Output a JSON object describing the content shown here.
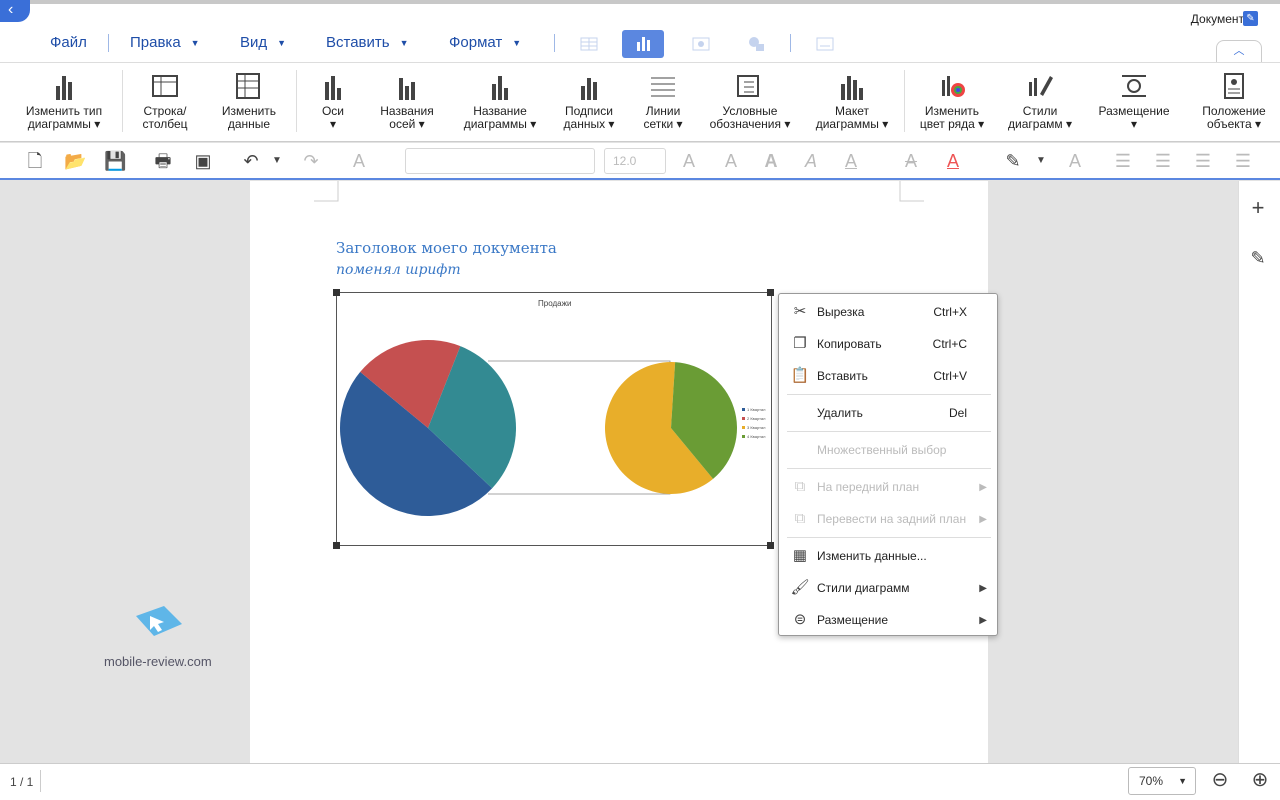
{
  "window": {
    "doc_label": "Документ"
  },
  "menu": [
    {
      "label": "Файл"
    },
    {
      "label": "Правка"
    },
    {
      "label": "Вид"
    },
    {
      "label": "Вставить"
    },
    {
      "label": "Формат"
    }
  ],
  "ribbon": [
    {
      "label": "Изменить тип\nдиаграммы ▾"
    },
    {
      "label": "Строка/\nстолбец"
    },
    {
      "label": "Изменить\nданные"
    },
    {
      "label": "Оси\n▾"
    },
    {
      "label": "Названия\nосей ▾"
    },
    {
      "label": "Название\nдиаграммы ▾"
    },
    {
      "label": "Подписи\nданных ▾"
    },
    {
      "label": "Линии\nсетки ▾"
    },
    {
      "label": "Условные\nобозначения ▾"
    },
    {
      "label": "Макет\nдиаграммы ▾"
    },
    {
      "label": "Изменить\nцвет ряда ▾"
    },
    {
      "label": "Стили\nдиаграмм ▾"
    },
    {
      "label": "Размещение\n▾"
    },
    {
      "label": "Положение\nобъекта ▾"
    }
  ],
  "format_bar": {
    "font_size": "12.0"
  },
  "document": {
    "title": "Заголовок моего документа",
    "subtitle": "поменял шрифт"
  },
  "chart_data": {
    "type": "pie",
    "title": "Продажи",
    "legend": [
      "1 Квартал",
      "2 Квартал",
      "3 Квартал",
      "4 Квартал"
    ],
    "legend_position": "right",
    "slices": [
      {
        "color": "#2e5c98",
        "share": 0.5
      },
      {
        "color": "#c55050",
        "share": 0.2
      },
      {
        "color": "#338a92",
        "share": 0.3
      }
    ],
    "secondary_slices": [
      {
        "color": "#e8ae2a",
        "share": 0.61
      },
      {
        "color": "#6a9c35",
        "share": 0.39
      }
    ],
    "colors": [
      "#2e5c98",
      "#c55050",
      "#e8ae2a",
      "#6a9c35"
    ]
  },
  "context_menu": {
    "cut": {
      "label": "Вырезка",
      "shortcut": "Ctrl+X"
    },
    "copy": {
      "label": "Копировать",
      "shortcut": "Ctrl+C"
    },
    "paste": {
      "label": "Вставить",
      "shortcut": "Ctrl+V"
    },
    "delete": {
      "label": "Удалить",
      "shortcut": "Del"
    },
    "multi": {
      "label": "Множественный выбор"
    },
    "front": {
      "label": "На передний план"
    },
    "back": {
      "label": "Перевести на задний план"
    },
    "edit_data": {
      "label": "Изменить данные..."
    },
    "styles": {
      "label": "Стили диаграмм"
    },
    "placement": {
      "label": "Размещение"
    }
  },
  "status": {
    "page": "1 / 1",
    "zoom": "70%"
  },
  "watermark": {
    "text": "mobile-review.com"
  }
}
